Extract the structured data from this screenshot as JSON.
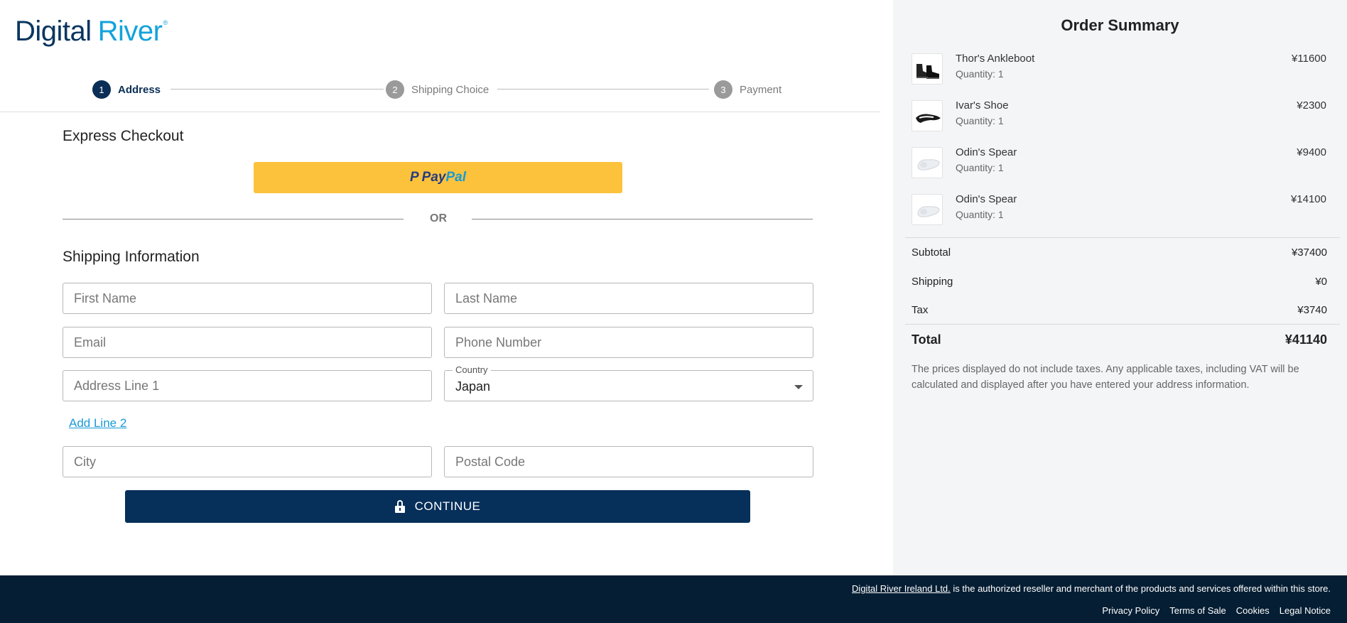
{
  "logo": {
    "word1": "Digital",
    "word2": "River",
    "reg": "®"
  },
  "stepper": {
    "steps": [
      {
        "num": "1",
        "label": "Address"
      },
      {
        "num": "2",
        "label": "Shipping Choice"
      },
      {
        "num": "3",
        "label": "Payment"
      }
    ],
    "active_step": "1"
  },
  "express": {
    "heading": "Express Checkout",
    "paypal": {
      "mark": "P",
      "pay": "Pay",
      "pal": "Pal"
    },
    "or": "OR"
  },
  "shipping": {
    "heading": "Shipping Information",
    "first_name_placeholder": "First Name",
    "last_name_placeholder": "Last Name",
    "email_placeholder": "Email",
    "phone_placeholder": "Phone Number",
    "address1_placeholder": "Address Line 1",
    "country_label": "Country",
    "country_value": "Japan",
    "add_line2": "Add Line 2",
    "city_placeholder": "City",
    "postal_placeholder": "Postal Code",
    "continue_label": "CONTINUE"
  },
  "order_summary": {
    "title": "Order Summary",
    "items": [
      {
        "name": "Thor's Ankleboot",
        "qty": "Quantity: 1",
        "price": "¥11600"
      },
      {
        "name": "Ivar's Shoe",
        "qty": "Quantity: 1",
        "price": "¥2300"
      },
      {
        "name": "Odin's Spear",
        "qty": "Quantity: 1",
        "price": "¥9400"
      },
      {
        "name": "Odin's Spear",
        "qty": "Quantity: 1",
        "price": "¥14100"
      }
    ],
    "subtotal_label": "Subtotal",
    "subtotal_value": "¥37400",
    "shipping_label": "Shipping",
    "shipping_value": "¥0",
    "tax_label": "Tax",
    "tax_value": "¥3740",
    "total_label": "Total",
    "total_value": "¥41140",
    "note": "The prices displayed do not include taxes. Any applicable taxes, including VAT will be calculated and displayed after you have entered your address information."
  },
  "footer": {
    "reseller_link": "Digital River Ireland Ltd.",
    "reseller_text": " is the authorized reseller and merchant of the products and services offered within this store.",
    "links": [
      "Privacy Policy",
      "Terms of Sale",
      "Cookies",
      "Legal Notice"
    ]
  },
  "colors": {
    "brand_navy": "#062f5a",
    "brand_blue": "#13a3dc",
    "paypal_yellow": "#fcc23b",
    "footer_bg": "#061e33",
    "sidebar_bg": "#f4f5f7"
  }
}
